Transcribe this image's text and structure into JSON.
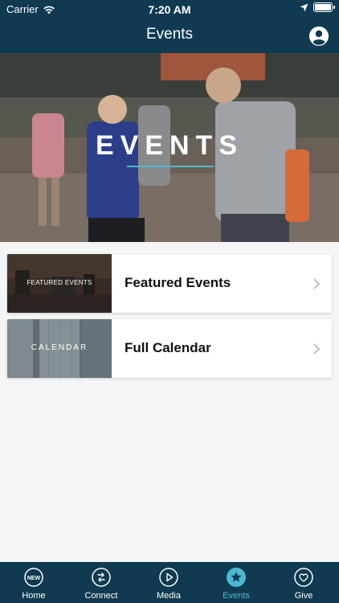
{
  "status_bar": {
    "carrier": "Carrier",
    "time": "7:20 AM"
  },
  "header": {
    "title": "Events"
  },
  "hero": {
    "title": "EVENTS"
  },
  "cards": [
    {
      "thumb_label": "FEATURED EVENTS",
      "title": "Featured Events"
    },
    {
      "thumb_label": "CALENDAR",
      "title": "Full Calendar"
    }
  ],
  "tabbar": {
    "tabs": [
      {
        "label": "Home",
        "icon": "new-badge-icon"
      },
      {
        "label": "Connect",
        "icon": "connect-icon"
      },
      {
        "label": "Media",
        "icon": "play-icon"
      },
      {
        "label": "Events",
        "icon": "star-icon",
        "active": true
      },
      {
        "label": "Give",
        "icon": "heart-icon"
      }
    ]
  },
  "colors": {
    "primary": "#0f3a50",
    "accent": "#4fb8d0",
    "background": "#f4f5f7"
  }
}
